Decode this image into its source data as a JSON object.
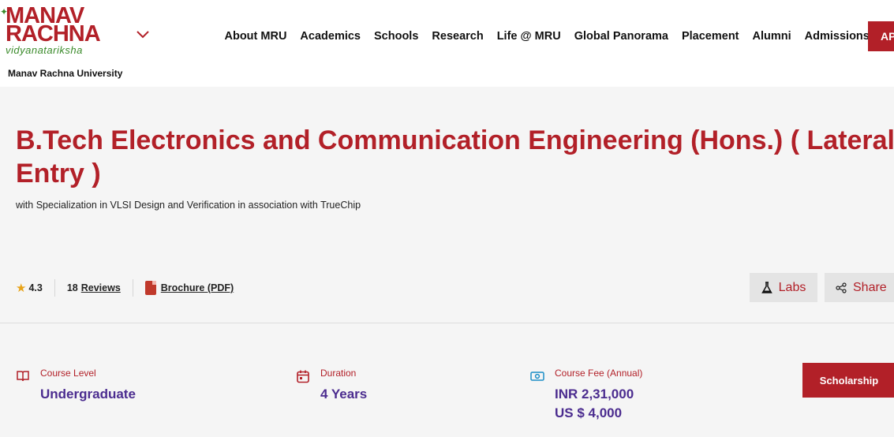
{
  "brand": {
    "logo_line1": "MANAV",
    "logo_line2": "RACHNA",
    "logo_tagline": "vidyanatariksha",
    "university_name": "Manav Rachna University"
  },
  "nav": {
    "items": [
      "About MRU",
      "Academics",
      "Schools",
      "Research",
      "Life @ MRU",
      "Global Panorama",
      "Placement",
      "Alumni",
      "Admissions"
    ],
    "apply_label": "AP"
  },
  "program": {
    "title": "B.Tech Electronics and Communication Engineering (Hons.) ( Lateral Entry )",
    "subtitle": "with Specialization in VLSI Design and Verification in association with TrueChip"
  },
  "meta": {
    "rating": "4.3",
    "reviews_count": "18",
    "reviews_label": "Reviews",
    "brochure_label": "Brochure (PDF)"
  },
  "actions": {
    "labs_label": "Labs",
    "share_label": "Share",
    "scholarship_label": "Scholarship"
  },
  "info": {
    "course_level_label": "Course Level",
    "course_level_value": "Undergraduate",
    "duration_label": "Duration",
    "duration_value": "4 Years",
    "fee_label": "Course Fee (Annual)",
    "fee_inr": "INR 2,31,000",
    "fee_usd": "US $ 4,000"
  },
  "colors": {
    "brand_red": "#b22028",
    "value_purple": "#4b2c8f",
    "star_gold": "#e8a317"
  }
}
